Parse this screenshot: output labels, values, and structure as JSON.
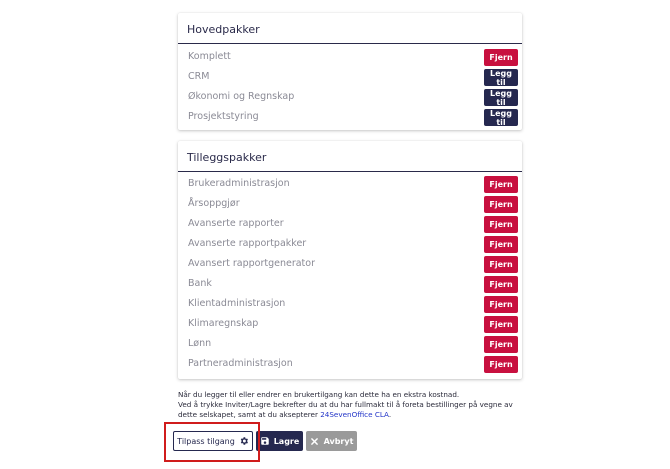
{
  "main_packages": {
    "title": "Hovedpakker",
    "items": [
      {
        "label": "Komplett",
        "action": "Fjern"
      },
      {
        "label": "CRM",
        "action": "Legg til"
      },
      {
        "label": "Økonomi og Regnskap",
        "action": "Legg til"
      },
      {
        "label": "Prosjektstyring",
        "action": "Legg til"
      }
    ]
  },
  "extra_packages": {
    "title": "Tilleggspakker",
    "items": [
      {
        "label": "Brukeradministrasjon",
        "action": "Fjern"
      },
      {
        "label": "Årsoppgjør",
        "action": "Fjern"
      },
      {
        "label": "Avanserte rapporter",
        "action": "Fjern"
      },
      {
        "label": "Avanserte rapportpakker",
        "action": "Fjern"
      },
      {
        "label": "Avansert rapportgenerator",
        "action": "Fjern"
      },
      {
        "label": "Bank",
        "action": "Fjern"
      },
      {
        "label": "Klientadministrasjon",
        "action": "Fjern"
      },
      {
        "label": "Klimaregnskap",
        "action": "Fjern"
      },
      {
        "label": "Lønn",
        "action": "Fjern"
      },
      {
        "label": "Partneradministrasjon",
        "action": "Fjern"
      }
    ]
  },
  "notice": {
    "line1": "Når du legger til eller endrer en brukertilgang kan dette ha en ekstra kostnad.",
    "line2": "Ved å trykke Inviter/Lagre bekrefter du at du har fullmakt til å foreta bestillinger på vegne av",
    "line3_prefix": "dette selskapet, samt at du aksepterer ",
    "link": "24SevenOffice CLA",
    "line3_suffix": "."
  },
  "actions": {
    "customize": "Tilpass tilgang",
    "save": "Lagre",
    "cancel": "Avbryt"
  },
  "colors": {
    "remove": "#c8103f",
    "add": "#25284f",
    "cancel": "#9a9a9a",
    "highlight": "#d01c1c"
  },
  "icons": {
    "customize": "gear-icon",
    "save": "floppy-disk-icon",
    "cancel": "close-icon"
  }
}
